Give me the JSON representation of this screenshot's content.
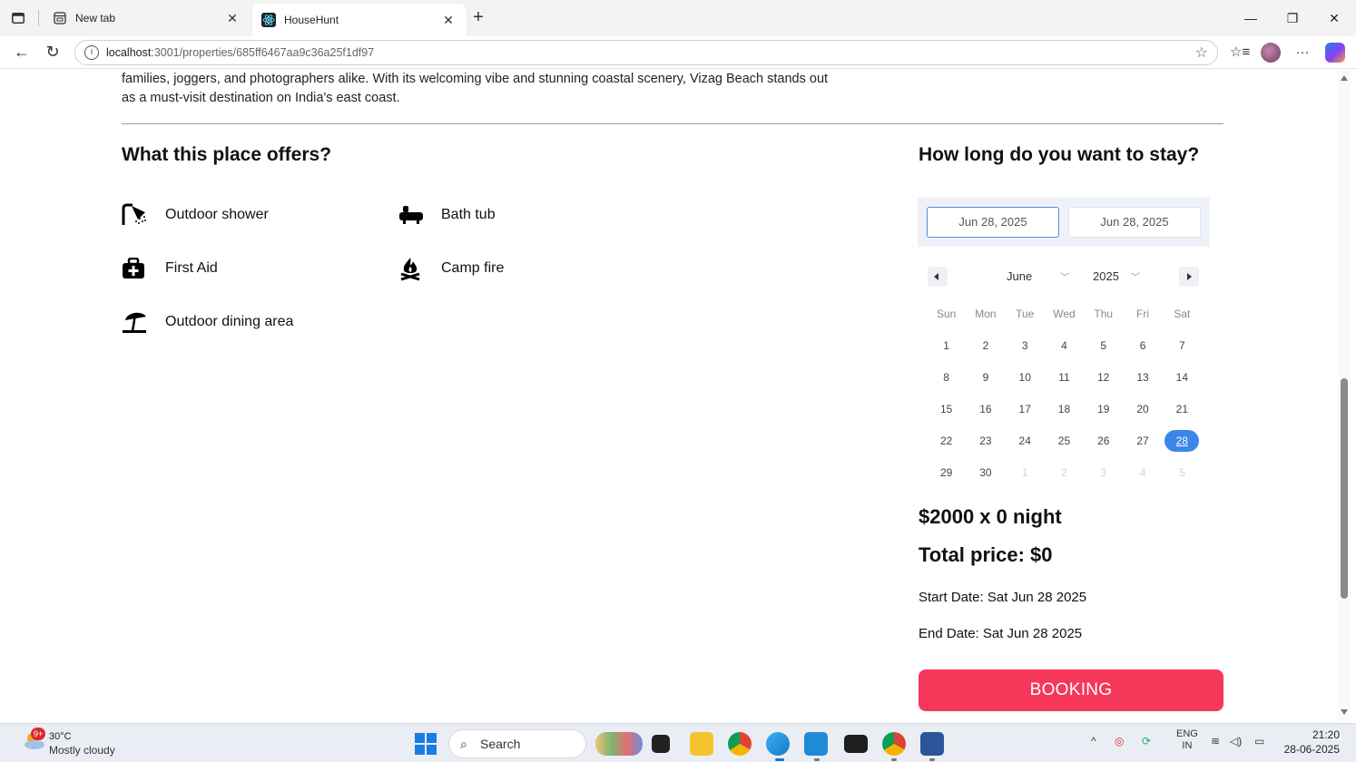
{
  "browser": {
    "tabs": [
      {
        "title": "New tab",
        "active": false
      },
      {
        "title": "HouseHunt",
        "active": true
      }
    ],
    "url_host": "localhost",
    "url_path": ":3001/properties/685ff6467aa9c36a25f1df97"
  },
  "page": {
    "description": "families, joggers, and photographers alike. With its welcoming vibe and stunning coastal scenery, Vizag Beach stands out as a must-visit destination on India's east coast.",
    "amenities_heading": "What this place offers?",
    "amenities": [
      {
        "label": "Outdoor shower",
        "icon": "shower-icon"
      },
      {
        "label": "Bath tub",
        "icon": "bathtub-icon"
      },
      {
        "label": "First Aid",
        "icon": "first-aid-icon"
      },
      {
        "label": "Camp fire",
        "icon": "campfire-icon"
      },
      {
        "label": "Outdoor dining area",
        "icon": "umbrella-table-icon"
      }
    ],
    "stay_heading": "How long do you want to stay?",
    "start_input": "Jun 28, 2025",
    "end_input": "Jun 28, 2025",
    "calendar": {
      "month": "June",
      "year": "2025",
      "weekdays": [
        "Sun",
        "Mon",
        "Tue",
        "Wed",
        "Thu",
        "Fri",
        "Sat"
      ],
      "weeks": [
        [
          "1",
          "2",
          "3",
          "4",
          "5",
          "6",
          "7"
        ],
        [
          "8",
          "9",
          "10",
          "11",
          "12",
          "13",
          "14"
        ],
        [
          "15",
          "16",
          "17",
          "18",
          "19",
          "20",
          "21"
        ],
        [
          "22",
          "23",
          "24",
          "25",
          "26",
          "27",
          "28"
        ],
        [
          "29",
          "30",
          "1",
          "2",
          "3",
          "4",
          "5"
        ]
      ],
      "selected_day": "28",
      "accent_color": "#3b86e8"
    },
    "nightly_price": "$2000 x 0 night",
    "total_price": "Total price: $0",
    "start_date": "Start Date: Sat Jun 28 2025",
    "end_date": "End Date: Sat Jun 28 2025",
    "booking_label": "BOOKING",
    "booking_color": "#f5385a"
  },
  "taskbar": {
    "weather_badge": "9+",
    "weather_temp": "30°C",
    "weather_desc": "Mostly cloudy",
    "search_label": "Search",
    "lang_top": "ENG",
    "lang_bottom": "IN",
    "time": "21:20",
    "date": "28-06-2025"
  }
}
